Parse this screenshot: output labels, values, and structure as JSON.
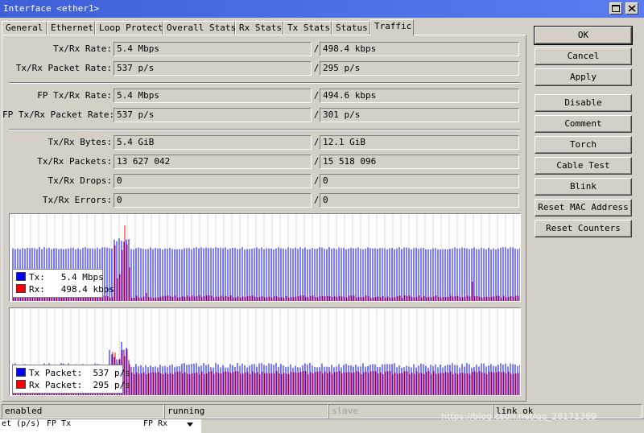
{
  "window": {
    "title": "Interface <ether1>"
  },
  "tabs": [
    {
      "label": "General"
    },
    {
      "label": "Ethernet"
    },
    {
      "label": "Loop Protect"
    },
    {
      "label": "Overall Stats"
    },
    {
      "label": "Rx Stats"
    },
    {
      "label": "Tx Stats"
    },
    {
      "label": "Status"
    },
    {
      "label": "Traffic",
      "active": true
    }
  ],
  "stats": {
    "separator": "/",
    "rows": [
      {
        "label": "Tx/Rx Rate:",
        "tx": "5.4 Mbps",
        "rx": "498.4 kbps"
      },
      {
        "label": "Tx/Rx Packet Rate:",
        "tx": "537 p/s",
        "rx": "295 p/s"
      },
      {
        "label": "FP Tx/Rx Rate:",
        "tx": "5.4 Mbps",
        "rx": "494.6 kbps"
      },
      {
        "label": "FP Tx/Rx Packet Rate:",
        "tx": "537 p/s",
        "rx": "301 p/s"
      },
      {
        "label": "Tx/Rx Bytes:",
        "tx": "5.4 GiB",
        "rx": "12.1 GiB"
      },
      {
        "label": "Tx/Rx Packets:",
        "tx": "13 627 042",
        "rx": "15 518 096"
      },
      {
        "label": "Tx/Rx Drops:",
        "tx": "0",
        "rx": "0"
      },
      {
        "label": "Tx/Rx Errors:",
        "tx": "0",
        "rx": "0"
      }
    ]
  },
  "graphs": {
    "tx_color": "#0000ff",
    "rx_color": "#ff0000",
    "bits": {
      "legend_tx": "Tx:   5.4 Mbps",
      "legend_rx": "Rx:   498.4 kbps"
    },
    "packets": {
      "legend_tx": "Tx Packet:  537 p/s",
      "legend_rx": "Rx Packet:  295 p/s"
    }
  },
  "buttons": [
    {
      "label": "OK",
      "default": true
    },
    {
      "label": "Cancel"
    },
    {
      "label": "Apply"
    },
    {
      "label": "Disable"
    },
    {
      "label": "Comment"
    },
    {
      "label": "Torch"
    },
    {
      "label": "Cable Test"
    },
    {
      "label": "Blink"
    },
    {
      "label": "Reset MAC Address"
    },
    {
      "label": "Reset Counters"
    }
  ],
  "statusbar": {
    "state": "enabled",
    "run": "running",
    "slave": "slave",
    "link": "link ok"
  },
  "background": {
    "col1": "et (p/s)",
    "col2": "FP Tx",
    "col3": "FP Rx"
  },
  "watermark": "https://blog.csdn.net/qq_28171389"
}
